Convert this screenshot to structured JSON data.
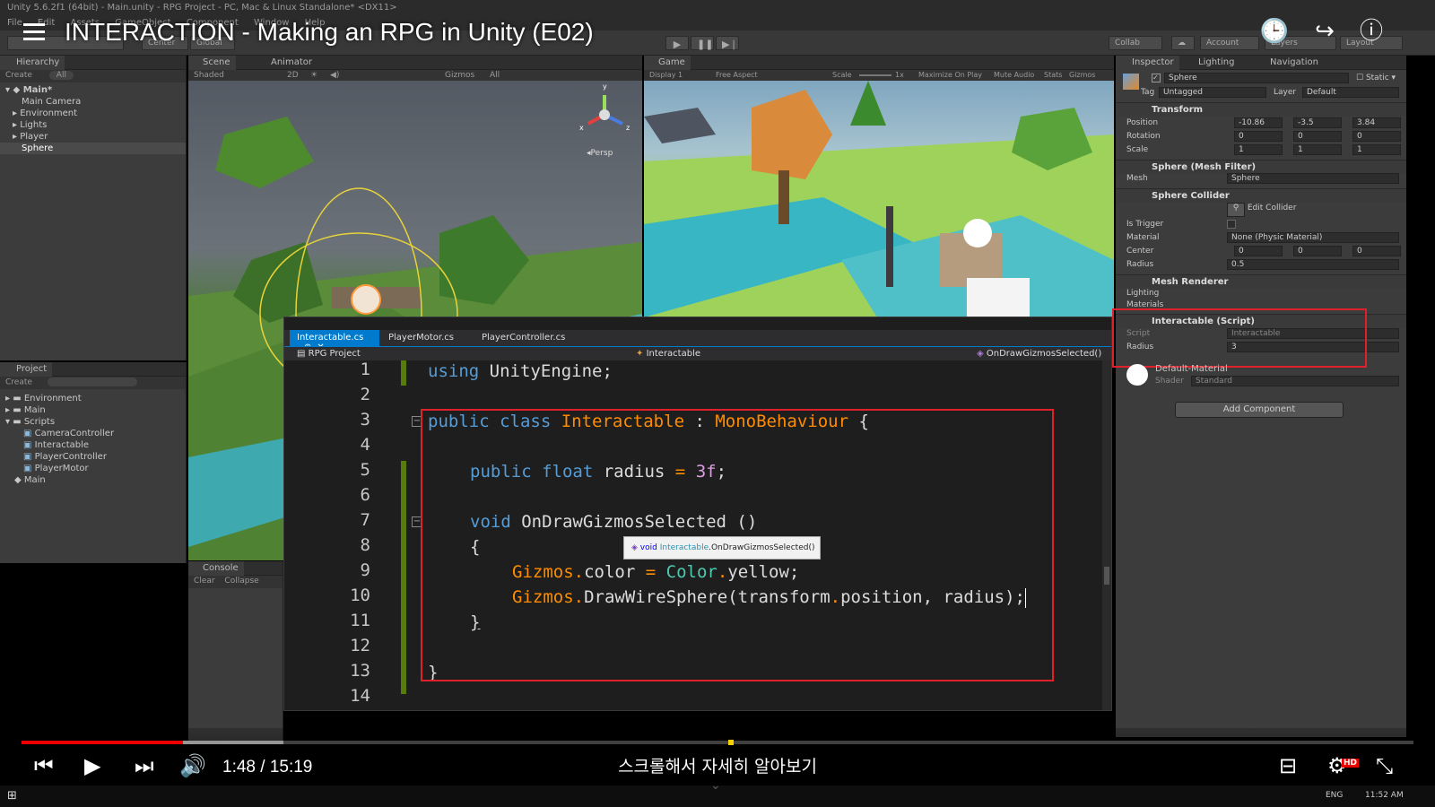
{
  "window": {
    "title": "Unity 5.6.2f1 (64bit) - Main.unity - RPG Project - PC, Mac & Linux Standalone* <DX11>",
    "menu": [
      "File",
      "Edit",
      "Assets",
      "GameObject",
      "Component",
      "Window",
      "Help"
    ]
  },
  "video": {
    "title": "INTERACTION - Making an RPG in Unity (E02)",
    "time": "1:48 / 15:19",
    "caption": "스크롤해서 자세히 알아보기",
    "progress_fraction": 0.116,
    "buffered_fraction": 0.188
  },
  "toolbar": {
    "center": "Center",
    "global": "Global",
    "collab": "Collab",
    "account": "Account",
    "layers": "Layers",
    "layout": "Layout"
  },
  "hierarchy": {
    "tab": "Hierarchy",
    "create": "Create",
    "search": "All",
    "scene": "Main*",
    "items": [
      "Main Camera",
      "Environment",
      "Lights",
      "Player",
      "Sphere"
    ]
  },
  "project": {
    "tab": "Project",
    "create": "Create",
    "items": [
      "Environment",
      "Main",
      "Scripts",
      "CameraController",
      "Interactable",
      "PlayerController",
      "PlayerMotor",
      "Main"
    ]
  },
  "console": {
    "tab": "Console",
    "clear": "Clear",
    "collapse": "Collapse",
    "clear2": "Clea"
  },
  "scene": {
    "tab": "Scene",
    "animator_tab": "Animator",
    "shaded": "Shaded",
    "mode2d": "2D",
    "gizmos": "Gizmos",
    "search": "All",
    "persp": "Persp",
    "axis_x": "x",
    "axis_y": "y",
    "axis_z": "z"
  },
  "game": {
    "tab": "Game",
    "display": "Display 1",
    "aspect": "Free Aspect",
    "scale": "Scale",
    "scale_val": "1x",
    "maximize": "Maximize On Play",
    "mute": "Mute Audio",
    "stats": "Stats",
    "gizmos": "Gizmos"
  },
  "editor": {
    "tabs": [
      "Interactable.cs",
      "PlayerMotor.cs",
      "PlayerController.cs"
    ],
    "nav_project": "RPG Project",
    "nav_class": "Interactable",
    "nav_method": "OnDrawGizmosSelected()",
    "tooltip_void": "void",
    "tooltip_class": "Interactable",
    "tooltip_method": ".OnDrawGizmosSelected()",
    "line_numbers": [
      "1",
      "2",
      "3",
      "4",
      "5",
      "6",
      "7",
      "8",
      "9",
      "10",
      "11",
      "12",
      "13",
      "14"
    ],
    "code": {
      "l1_kw": "using",
      "l1_rest": " UnityEngine;",
      "l3_kw": "public class",
      "l3_cls": "Interactable",
      "l3_colon": " : ",
      "l3_base": "MonoBehaviour",
      "l3_brace": " {",
      "l5_kw": "public float",
      "l5_name": " radius ",
      "l5_eq": "=",
      "l5_val": " 3f",
      "l5_semi": ";",
      "l7_kw": "void",
      "l7_rest": " OnDrawGizmosSelected ()",
      "l8": "{",
      "l9_a": "Gizmos",
      "l9_dot": ".",
      "l9_b": "color ",
      "l9_eq": "=",
      "l9_c": " Color",
      "l9_dot2": ".",
      "l9_d": "yellow;",
      "l10_a": "Gizmos",
      "l10_dot": ".",
      "l10_b": "DrawWireSphere(transform",
      "l10_dot2": ".",
      "l10_c": "position, radius);",
      "l11": "}",
      "l13": "}"
    }
  },
  "inspector": {
    "tabs": [
      "Inspector",
      "Lighting",
      "Navigation"
    ],
    "object_name": "Sphere",
    "static": "Static",
    "tag_label": "Tag",
    "tag": "Untagged",
    "layer_label": "Layer",
    "layer": "Default",
    "transform": {
      "title": "Transform",
      "position_label": "Position",
      "rotation_label": "Rotation",
      "scale_label": "Scale",
      "position": [
        "-10.86",
        "-3.5",
        "3.84"
      ],
      "rotation": [
        "0",
        "0",
        "0"
      ],
      "scale": [
        "1",
        "1",
        "1"
      ]
    },
    "mesh_filter": {
      "title": "Sphere (Mesh Filter)",
      "mesh_label": "Mesh",
      "mesh": "Sphere"
    },
    "collider": {
      "title": "Sphere Collider",
      "edit": "Edit Collider",
      "trigger_label": "Is Trigger",
      "material_label": "Material",
      "material": "None (Physic Material)",
      "center_label": "Center",
      "center": [
        "0",
        "0",
        "0"
      ],
      "radius_label": "Radius",
      "radius": "0.5"
    },
    "renderer": {
      "title": "Mesh Renderer",
      "lighting": "Lighting",
      "materials": "Materials"
    },
    "script": {
      "title": "Interactable (Script)",
      "script_label": "Script",
      "script": "Interactable",
      "radius_label": "Radius",
      "radius": "3"
    },
    "material": {
      "name": "Default-Material",
      "shader_label": "Shader",
      "shader": "Standard"
    },
    "add_component": "Add Component"
  },
  "taskbar": {
    "lang": "ENG",
    "clock": "11:52 AM"
  },
  "colors": {
    "red_box": "#e0202a",
    "progress": "#e00000",
    "accent": "#007acc"
  }
}
